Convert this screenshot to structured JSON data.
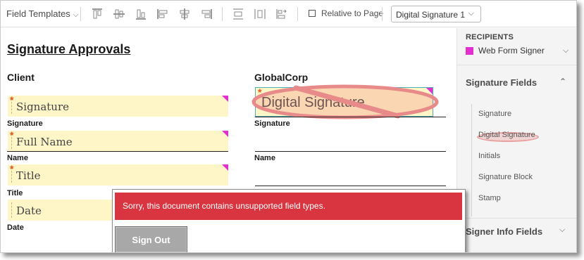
{
  "toolbar": {
    "templates_label": "Field Templates",
    "relative_label": "Relative to Page",
    "field_select_value": "Digital Signature 1",
    "icons": [
      "align-top-icon",
      "align-middle-icon",
      "align-bottom-icon",
      "align-left-icon",
      "align-center-icon",
      "align-right-icon",
      "distribute-vertical-icon",
      "distribute-horizontal-icon",
      "match-size-icon"
    ]
  },
  "document": {
    "title": "Signature Approvals",
    "client": {
      "heading": "Client",
      "fields": [
        {
          "placeholder": "Signature",
          "label": "Signature",
          "required": true
        },
        {
          "placeholder": "Full Name",
          "label": "Name",
          "required": true
        },
        {
          "placeholder": "Title",
          "label": "Title",
          "required": true
        },
        {
          "placeholder": "Date",
          "label": "Date",
          "required": false
        }
      ]
    },
    "globalcorp": {
      "heading": "GlobalCorp",
      "signature_placeholder": "Digital Signature",
      "signature_label": "Signature",
      "name_label": "Name"
    }
  },
  "sidebar": {
    "recipients_heading": "RECIPIENTS",
    "recipient_name": "Web Form Signer",
    "recipient_color": "#e42fd0",
    "signature_fields_heading": "Signature Fields",
    "signature_items": [
      "Signature",
      "Digital Signature",
      "Initials",
      "Signature Block",
      "Stamp"
    ],
    "signer_info_heading": "Signer Info Fields"
  },
  "dialog": {
    "message": "Sorry, this document contains unsupported field types.",
    "button_label": "Sign Out",
    "accent_color": "#d93540"
  }
}
